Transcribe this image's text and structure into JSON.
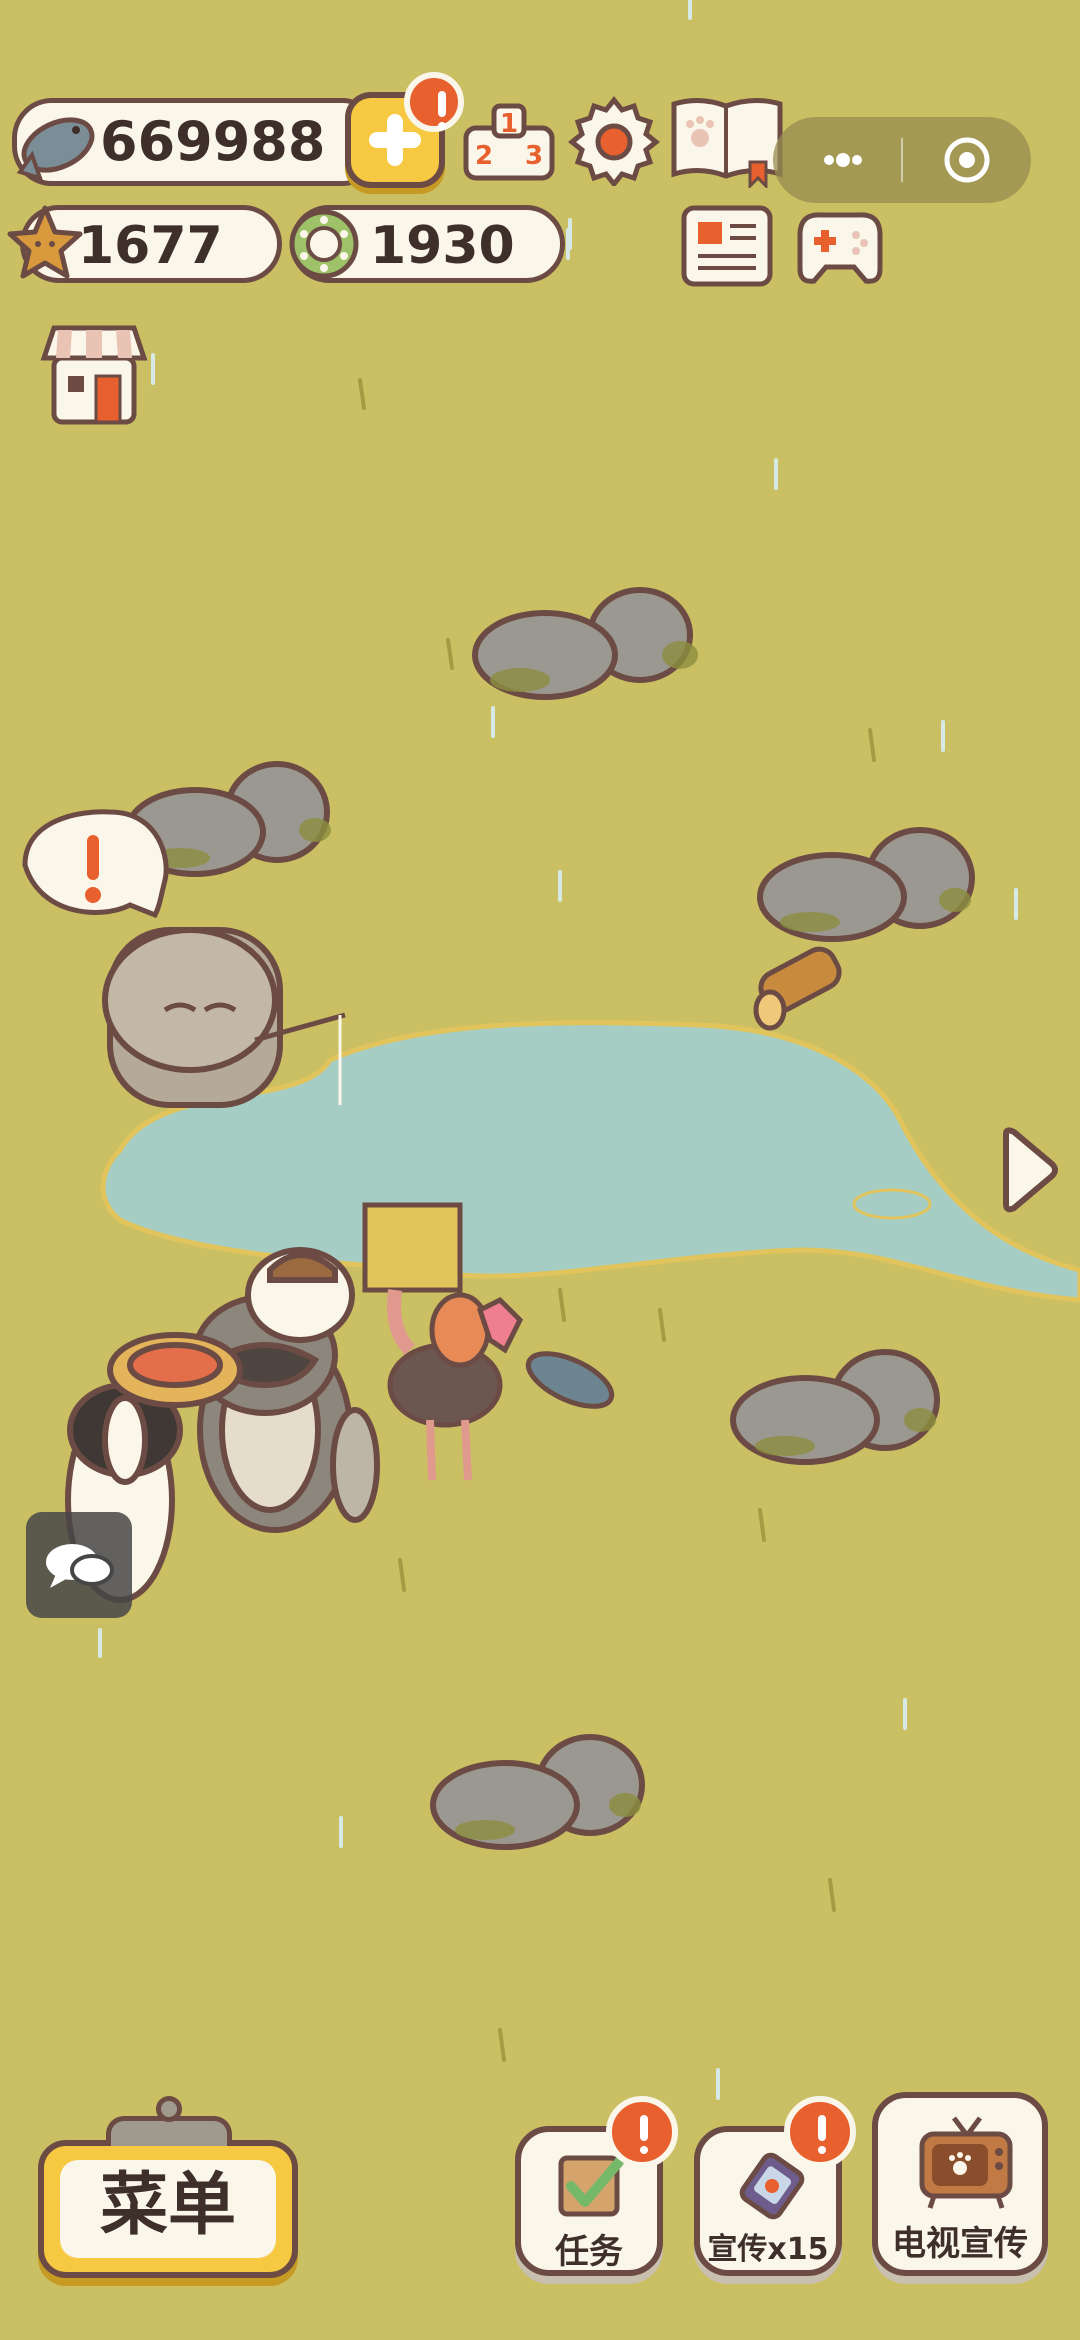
{
  "hud": {
    "fish_count": "669988",
    "star_count": "1677",
    "ring_count": "1930"
  },
  "bottom": {
    "menu_label": "菜单",
    "task_label": "任务",
    "promo_label": "宣传x15",
    "tv_label": "电视宣传"
  },
  "icons": {
    "fish": "fish-icon",
    "star": "star-icon",
    "ring": "ring-icon",
    "plus": "plus-icon",
    "leaderboard": "leaderboard-podium-icon",
    "settings": "gear-icon",
    "book": "paw-book-icon",
    "news": "newspaper-icon",
    "gamepad": "gamepad-icon",
    "shop": "shop-icon",
    "chat": "chat-bubble-icon",
    "arrow": "right-arrow-icon"
  },
  "colors": {
    "background": "#cbbf63",
    "pond": "#a6cdc4",
    "outline": "#6b4b43",
    "badge": "#e8602e",
    "panel": "#fbf6ea"
  }
}
